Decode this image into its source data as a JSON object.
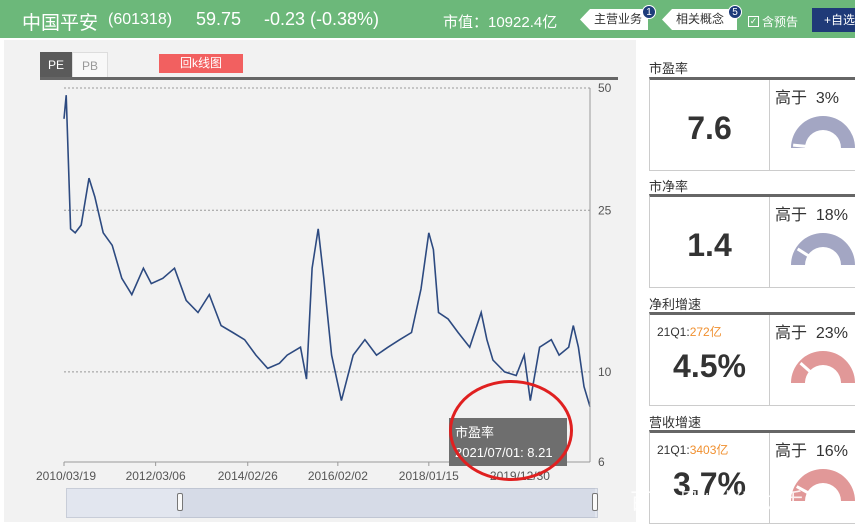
{
  "header": {
    "name": "中国平安",
    "code": "(601318)",
    "price": "59.75",
    "change": "-0.23 (-0.38%)",
    "market_cap": "市值：10922.4亿",
    "main_business": "主营业务",
    "main_business_count": "1",
    "related_concepts": "相关概念",
    "related_concepts_count": "5",
    "forecast_label": "含预告",
    "watchlist_label": "+自选"
  },
  "chart_panel": {
    "tabs": [
      {
        "label": "PE",
        "active": true
      },
      {
        "label": "PB",
        "active": false
      }
    ],
    "kline_button": "回k线图",
    "tooltip": {
      "title": "市盈率",
      "value": "2021/07/01: 8.21"
    }
  },
  "chart_data": {
    "type": "line",
    "title": "",
    "xlabel": "",
    "ylabel": "",
    "y_scale": "log",
    "ylim": [
      6,
      50
    ],
    "yticks": [
      50,
      25,
      10,
      6
    ],
    "grid": "horizontal dotted",
    "x_tick_labels": [
      "2010/03/19",
      "2012/03/06",
      "2014/02/26",
      "2016/02/02",
      "2018/01/15",
      "2019/12/30"
    ],
    "x_start": "2010/03/19",
    "x_end": "2021/07/01",
    "series": [
      {
        "color": "#2d4a80",
        "x": [
          "2010/03/19",
          "2010/04/05",
          "2010/05/10",
          "2010/06/15",
          "2010/08/01",
          "2010/10/01",
          "2010/11/15",
          "2011/01/20",
          "2011/04/01",
          "2011/06/15",
          "2011/09/01",
          "2011/12/01",
          "2012/02/01",
          "2012/05/01",
          "2012/08/01",
          "2012/11/01",
          "2013/02/01",
          "2013/05/01",
          "2013/08/01",
          "2013/11/01",
          "2014/02/01",
          "2014/05/01",
          "2014/08/01",
          "2014/11/01",
          "2015/01/01",
          "2015/04/15",
          "2015/06/01",
          "2015/07/15",
          "2015/09/01",
          "2015/10/15",
          "2015/12/15",
          "2016/03/01",
          "2016/06/01",
          "2016/09/01",
          "2016/12/01",
          "2017/03/01",
          "2017/06/01",
          "2017/09/01",
          "2017/11/15",
          "2018/01/15",
          "2018/02/20",
          "2018/04/01",
          "2018/06/15",
          "2018/09/01",
          "2018/12/01",
          "2019/03/01",
          "2019/04/15",
          "2019/06/01",
          "2019/09/01",
          "2019/12/01",
          "2020/02/01",
          "2020/03/20",
          "2020/06/01",
          "2020/09/01",
          "2020/11/01",
          "2021/01/15",
          "2021/02/20",
          "2021/04/01",
          "2021/05/15",
          "2021/07/01"
        ],
        "values": [
          42,
          48,
          22.5,
          22,
          23,
          30,
          27,
          22,
          20.5,
          17,
          15.5,
          18,
          16.5,
          17,
          18,
          15,
          14,
          15.5,
          13,
          12.5,
          12,
          11,
          10.2,
          10.5,
          11,
          11.5,
          9.6,
          18,
          22.5,
          17,
          11,
          8.5,
          11,
          12,
          11,
          11.5,
          12,
          12.5,
          16,
          22,
          20,
          14,
          13.5,
          12.5,
          11.5,
          14,
          12,
          10.7,
          10,
          9.8,
          11,
          8.5,
          11.5,
          12,
          11,
          11.5,
          13,
          11.5,
          9.2,
          8.21
        ]
      }
    ]
  },
  "stats": [
    {
      "title": "市盈率",
      "value": "7.6",
      "sub_label": "",
      "sub_value": "",
      "rank_label": "高于",
      "rank_value": "3%",
      "gauge_fraction": 0.03,
      "gauge_color": "#a3a6c3"
    },
    {
      "title": "市净率",
      "value": "1.4",
      "sub_label": "",
      "sub_value": "",
      "rank_label": "高于",
      "rank_value": "18%",
      "gauge_fraction": 0.18,
      "gauge_color": "#a3a6c3"
    },
    {
      "title": "净利增速",
      "value": "4.5%",
      "sub_label": "21Q1:",
      "sub_value": "272亿",
      "rank_label": "高于",
      "rank_value": "23%",
      "gauge_fraction": 0.23,
      "gauge_color": "#e19898"
    },
    {
      "title": "营收增速",
      "value": "3.7%",
      "sub_label": "21Q1:",
      "sub_value": "3403亿",
      "rank_label": "高于",
      "rank_value": "16%",
      "gauge_fraction": 0.16,
      "gauge_color": "#e19898"
    }
  ],
  "watermark": "百家号/财经助手"
}
